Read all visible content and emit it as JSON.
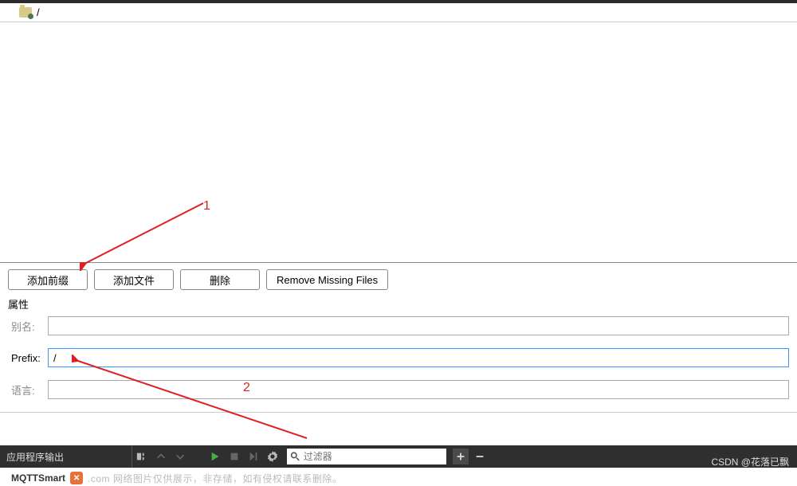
{
  "path": {
    "value": "/"
  },
  "buttons": {
    "add_prefix": "添加前缀",
    "add_file": "添加文件",
    "delete": "删除",
    "remove_missing": "Remove Missing Files"
  },
  "section": {
    "title": "属性"
  },
  "form": {
    "alias_label": "别名:",
    "alias_value": "",
    "prefix_label": "Prefix:",
    "prefix_value": "/",
    "lang_label": "语言:",
    "lang_value": ""
  },
  "bottom": {
    "output_label": "应用程序输出",
    "filter_placeholder": "过滤器"
  },
  "status": {
    "app": "MQTTSmart",
    "note": ".com 网络图片仅供展示，非存储，如有侵权请联系删除。"
  },
  "watermark": "CSDN @花落已飘",
  "annotations": {
    "a1": "1",
    "a2": "2"
  }
}
